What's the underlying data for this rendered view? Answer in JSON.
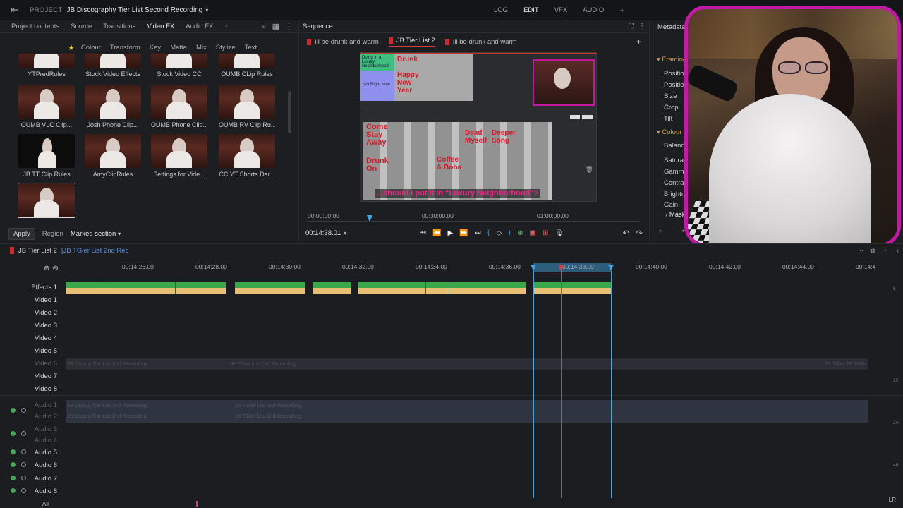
{
  "topbar": {
    "project_label": "PROJECT",
    "project_name": "JB Discography Tier List Second Recording",
    "modes": [
      "LOG",
      "EDIT",
      "VFX",
      "AUDIO"
    ],
    "active_mode": "EDIT"
  },
  "left_panel": {
    "tabs": [
      "Project contents",
      "Source",
      "Transitions",
      "Video FX",
      "Audio FX"
    ],
    "active_tab": "Video FX",
    "subtabs": [
      "Colour",
      "Transform",
      "Key",
      "Matte",
      "Mix",
      "Stylize",
      "Text"
    ],
    "clips": [
      {
        "label": "YTPredRules"
      },
      {
        "label": "Stock Video Effects"
      },
      {
        "label": "Stock Video CC"
      },
      {
        "label": "OUMB CLip Rules"
      },
      {
        "label": "OUMB VLC Clip..."
      },
      {
        "label": "Josh Phone Clip..."
      },
      {
        "label": "OUMB Phone Clip..."
      },
      {
        "label": "OUMB RV Clip Ru..."
      },
      {
        "label": "JB TT Clip Rules"
      },
      {
        "label": "AmyClipRules"
      },
      {
        "label": "Settings for Vide..."
      },
      {
        "label": "CC YT Shorts Dar..."
      },
      {
        "label": ""
      }
    ],
    "apply_label": "Apply",
    "region_label": "Region",
    "region_value": "Marked section"
  },
  "sequence": {
    "title": "Sequence",
    "tabs": [
      "Ill be drunk and warm",
      "JB Tier List 2",
      "Ill be drunk and warm"
    ],
    "active_tab": "JB Tier List 2",
    "viewer": {
      "red_texts": [
        "Drunk",
        "Happy New Year",
        "Come Stay Away",
        "Drunk On",
        "Coffee & Boba",
        "Dead Myself",
        "Deeper Song"
      ],
      "small_labels": [
        "Doing In a Luxury Neighborhood",
        "Not Right Now"
      ],
      "subtitle": "...should I put it in \"Luxury Neighborhood\"?"
    },
    "scrub_ticks": [
      "00:00:00.00",
      "00:30:00.00",
      "01:00:00.00"
    ],
    "timecode": "00:14:38.01"
  },
  "metadata": {
    "title": "Metadata",
    "groups": [
      {
        "name": "Framing",
        "props": [
          "Position",
          "Position",
          "Size",
          "Crop",
          "Tilt"
        ]
      },
      {
        "name": "Colour",
        "props": [
          "Balance",
          "Saturati",
          "Gamma",
          "Contras",
          "Brightn",
          "Gain"
        ]
      }
    ],
    "mask_label": "Mask"
  },
  "timeline": {
    "sequence_name": "JB Tier List 2",
    "sequence_sub": "[JB TGier List 2nd Rec",
    "ruler": [
      "00:14:26.00",
      "00:14:28.00",
      "00:14:30.00",
      "00:14:32.00",
      "00:14:34.00",
      "00:14:36.00",
      "00:14:38.00",
      "00:14:40.00",
      "00:14:42.00",
      "00:14:44.00",
      "00:14:4"
    ],
    "video_tracks": [
      {
        "label": "Effects 1",
        "dim": false
      },
      {
        "label": "Video 1",
        "dim": false
      },
      {
        "label": "Video 2",
        "dim": false
      },
      {
        "label": "Video 3",
        "dim": false
      },
      {
        "label": "Video 4",
        "dim": false
      },
      {
        "label": "Video 5",
        "dim": false
      },
      {
        "label": "Video 6",
        "dim": true
      },
      {
        "label": "Video 7",
        "dim": false
      },
      {
        "label": "Video 8",
        "dim": false
      }
    ],
    "audio_tracks": [
      {
        "label": "Audio 1",
        "dim": true
      },
      {
        "label": "Audio 2",
        "dim": true
      },
      {
        "label": "Audio 3",
        "dim": true
      },
      {
        "label": "Audio 4",
        "dim": true
      },
      {
        "label": "Audio 5",
        "dim": false
      },
      {
        "label": "Audio 6",
        "dim": false
      },
      {
        "label": "Audio 7",
        "dim": false
      },
      {
        "label": "Audio 8",
        "dim": false
      }
    ],
    "video6_clip_labels": [
      "JB Discog Tier List 2nd Recording",
      "JB TGier List 2nd Recording",
      "JB TGier",
      "JB TGier"
    ],
    "bottom_label": "All",
    "corner_label": "LR",
    "right_scale": [
      "6",
      "12",
      "24",
      "48"
    ]
  }
}
